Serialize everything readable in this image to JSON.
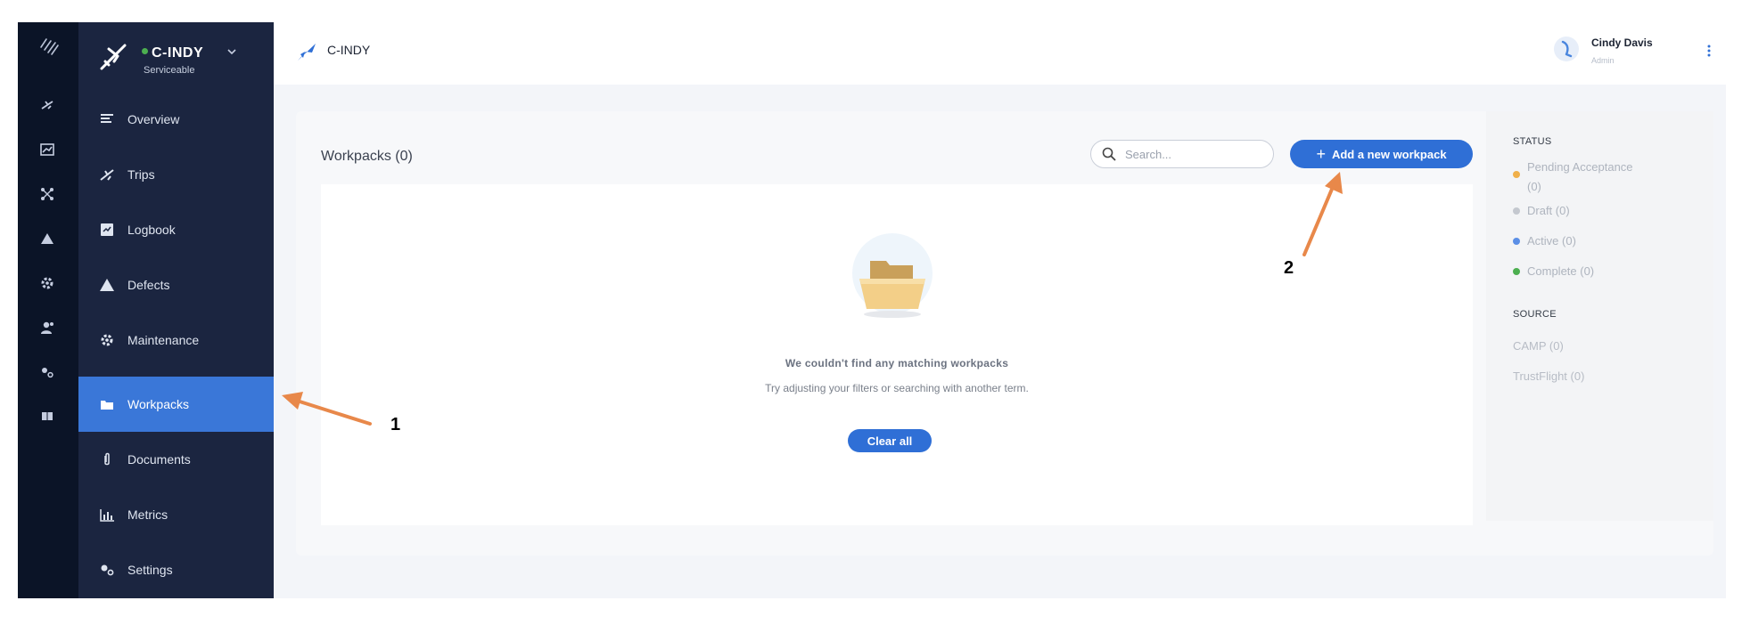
{
  "aircraft": {
    "name": "C-INDY",
    "status": "Serviceable",
    "status_color": "#4caf50"
  },
  "nav": {
    "items": [
      {
        "label": "Overview",
        "icon": "overview-icon"
      },
      {
        "label": "Trips",
        "icon": "trips-icon"
      },
      {
        "label": "Logbook",
        "icon": "logbook-icon"
      },
      {
        "label": "Defects",
        "icon": "defects-icon"
      },
      {
        "label": "Maintenance",
        "icon": "maintenance-icon"
      },
      {
        "label": "Workpacks",
        "icon": "workpacks-icon",
        "active": true
      },
      {
        "label": "Documents",
        "icon": "documents-icon"
      },
      {
        "label": "Metrics",
        "icon": "metrics-icon"
      },
      {
        "label": "Settings",
        "icon": "settings-icon"
      }
    ]
  },
  "topbar": {
    "title": "C-INDY",
    "user_name": "Cindy Davis",
    "user_role": "Admin"
  },
  "workpacks": {
    "title": "Workpacks (0)",
    "search_placeholder": "Search...",
    "add_label": "Add a new workpack",
    "empty_title": "We couldn't find any matching workpacks",
    "empty_text": "Try adjusting your filters or searching with another term.",
    "clear_label": "Clear all"
  },
  "filters": {
    "status_heading": "STATUS",
    "status": [
      {
        "label": "Pending Acceptance",
        "count": "(0)",
        "color": "#f0b04a"
      },
      {
        "label": "Draft (0)",
        "color": "#c4c8cf"
      },
      {
        "label": "Active (0)",
        "color": "#5b8fe6"
      },
      {
        "label": "Complete (0)",
        "color": "#4caf50"
      }
    ],
    "source_heading": "SOURCE",
    "source": [
      "CAMP (0)",
      "TrustFlight (0)"
    ]
  },
  "annotations": {
    "first": "1",
    "second": "2",
    "arrow_color": "#e8884a"
  },
  "colors": {
    "rail": "#0b1427",
    "sidebar": "#1b2540",
    "active": "#3a77d8",
    "primary": "#2f6fd6"
  }
}
